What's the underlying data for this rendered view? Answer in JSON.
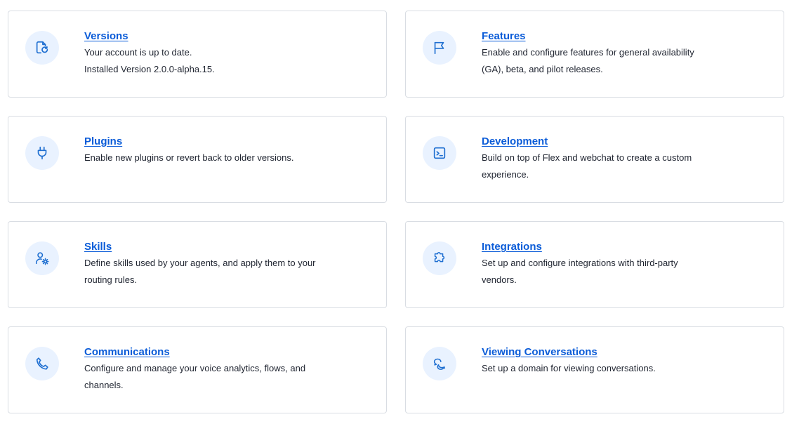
{
  "cards": [
    {
      "title": "Versions",
      "lines": [
        "Your account is up to date.",
        "Installed Version 2.0.0-alpha.15."
      ],
      "icon": "file-refresh-icon"
    },
    {
      "title": "Features",
      "lines": [
        "Enable and configure features for general availability",
        "(GA), beta, and pilot releases."
      ],
      "icon": "flag-icon"
    },
    {
      "title": "Plugins",
      "lines": [
        "Enable new plugins or revert back to older versions."
      ],
      "icon": "plug-icon"
    },
    {
      "title": "Development",
      "lines": [
        "Build on top of Flex and webchat to create a custom",
        "experience."
      ],
      "icon": "terminal-icon"
    },
    {
      "title": "Skills",
      "lines": [
        "Define skills used by your agents, and apply them to your",
        "routing rules."
      ],
      "icon": "user-settings-icon"
    },
    {
      "title": "Integrations",
      "lines": [
        "Set up and configure integrations with third-party",
        "vendors."
      ],
      "icon": "puzzle-icon"
    },
    {
      "title": "Communications",
      "lines": [
        "Configure and manage your voice analytics, flows, and",
        "channels."
      ],
      "icon": "phone-icon"
    },
    {
      "title": "Viewing Conversations",
      "lines": [
        "Set up a domain for viewing conversations."
      ],
      "icon": "chat-bubbles-icon"
    }
  ],
  "colors": {
    "link": "#0b5cd8",
    "icon": "#1f6fd1",
    "icon_bg": "#e9f2ff",
    "border": "#d9dde3",
    "text": "#1f2430"
  }
}
